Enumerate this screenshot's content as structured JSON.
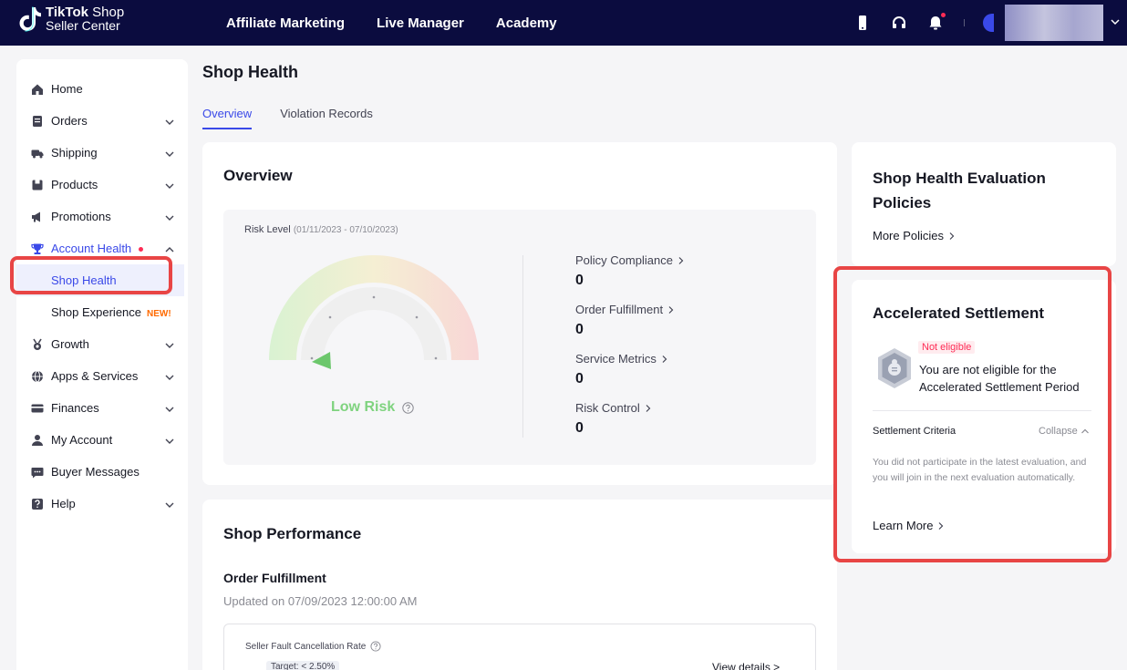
{
  "topbar": {
    "brand_line1_bold": "TikTok",
    "brand_line1_rest": " Shop",
    "brand_line2": "Seller Center",
    "nav": [
      "Affiliate Marketing",
      "Live Manager",
      "Academy"
    ],
    "icons": [
      "phone-icon",
      "headset-icon",
      "bell-icon",
      "chevron-down-icon"
    ]
  },
  "sidebar": {
    "items": [
      {
        "label": "Home",
        "icon": "home-icon"
      },
      {
        "label": "Orders",
        "icon": "orders-icon"
      },
      {
        "label": "Shipping",
        "icon": "truck-icon"
      },
      {
        "label": "Products",
        "icon": "box-icon"
      },
      {
        "label": "Promotions",
        "icon": "megaphone-icon"
      },
      {
        "label": "Account Health",
        "icon": "trophy-icon"
      },
      {
        "label": "Growth",
        "icon": "medal-icon"
      },
      {
        "label": "Apps & Services",
        "icon": "globe-icon"
      },
      {
        "label": "Finances",
        "icon": "card-icon"
      },
      {
        "label": "My Account",
        "icon": "user-icon"
      },
      {
        "label": "Buyer Messages",
        "icon": "chat-icon"
      },
      {
        "label": "Help",
        "icon": "help-icon"
      }
    ],
    "sub_items": {
      "shop_health": "Shop Health",
      "shop_experience": "Shop Experience",
      "new_badge": "NEW!"
    }
  },
  "header": {
    "title": "Shop Health",
    "tabs": [
      "Overview",
      "Violation Records"
    ]
  },
  "overview": {
    "title": "Overview",
    "risk_level_label": "Risk Level",
    "risk_period": "(01/11/2023 - 07/10/2023)",
    "risk_value": "Low Risk",
    "metrics": [
      {
        "label": "Policy Compliance",
        "value": "0"
      },
      {
        "label": "Order Fulfillment",
        "value": "0"
      },
      {
        "label": "Service Metrics",
        "value": "0"
      },
      {
        "label": "Risk Control",
        "value": "0"
      }
    ]
  },
  "performance": {
    "title": "Shop Performance",
    "subtitle": "Order Fulfillment",
    "updated": "Updated on 07/09/2023 12:00:00 AM",
    "metric_label": "Seller Fault Cancellation Rate",
    "target": "Target: < 2.50%",
    "value": "-",
    "view_details": "View details >"
  },
  "policies": {
    "title_line1": "Shop Health Evaluation",
    "title_line2": "Policies",
    "more_link": "More Policies"
  },
  "settlement": {
    "title": "Accelerated Settlement",
    "badge": "Not eligible",
    "message": "You are not eligible for the Accelerated Settlement Period",
    "criteria_label": "Settlement Criteria",
    "collapse_label": "Collapse",
    "criteria_text": "You did not participate in the latest evaluation, and you will join in the next evaluation automatically.",
    "learn_more": "Learn More"
  },
  "colors": {
    "topbar_bg": "#0b0c3f",
    "accent": "#3a49e8",
    "annotation_red": "#e84545",
    "low_risk_green": "#7fd37f",
    "alert_pink": "#fe2c55"
  }
}
